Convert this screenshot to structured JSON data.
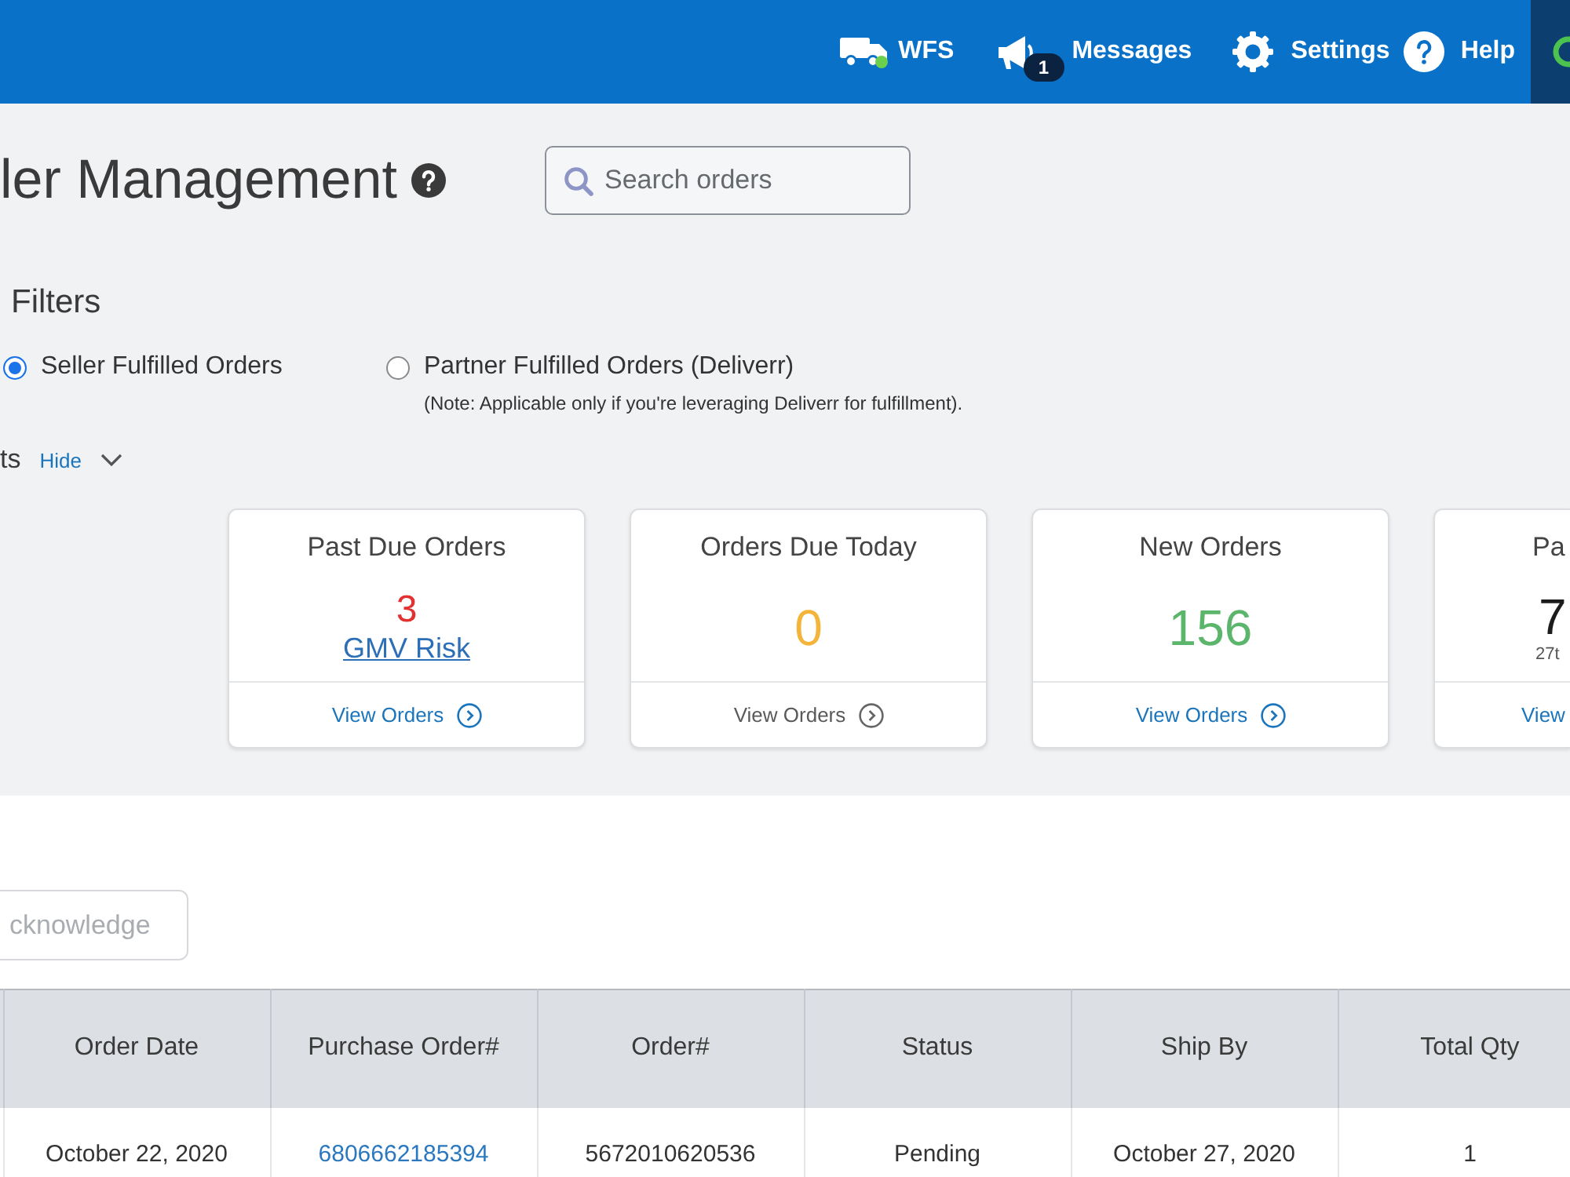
{
  "header": {
    "nav": [
      {
        "kind": "wfs",
        "label": "WFS"
      },
      {
        "kind": "messages",
        "label": "Messages",
        "badge": "1"
      },
      {
        "kind": "settings",
        "label": "Settings"
      },
      {
        "kind": "help",
        "label": "Help"
      }
    ]
  },
  "page": {
    "title": "ler Management",
    "search": {
      "placeholder": "Search orders"
    }
  },
  "filters": {
    "title": "Filters",
    "options": [
      {
        "label": "Seller Fulfilled Orders",
        "selected": true
      },
      {
        "label": "Partner Fulfilled Orders (Deliverr)",
        "selected": false,
        "note": "(Note: Applicable only if you're leveraging Deliverr for fulfillment)."
      }
    ]
  },
  "alerts": {
    "title": "ts",
    "toggle": "Hide",
    "cards": [
      {
        "kind": "whole",
        "title": "Past Due Orders",
        "value": "3",
        "color": "#e2312f",
        "link": "GMV Risk",
        "footer": {
          "label": "View Orders",
          "disabled": false
        }
      },
      {
        "kind": "whole",
        "title": "Orders Due Today",
        "value": "0",
        "color": "#f4b43a",
        "footer": {
          "label": "View Orders",
          "disabled": true
        }
      },
      {
        "kind": "whole",
        "title": "New Orders",
        "value": "156",
        "color": "#5bb56a",
        "footer": {
          "label": "View Orders",
          "disabled": false
        }
      },
      {
        "kind": "clipped",
        "title": "Pa",
        "value": "7",
        "color": "#1c1c1c",
        "subtext": "27t",
        "footer": {
          "label": "View",
          "disabled": false
        }
      }
    ]
  },
  "actions": {
    "acknowledge": {
      "label": "cknowledge",
      "disabled": true
    }
  },
  "table": {
    "columns": [
      "Order Date",
      "Purchase Order#",
      "Order#",
      "Status",
      "Ship By",
      "Total Qty"
    ],
    "rows": [
      {
        "cells": [
          {
            "kind": "text",
            "text": "October 22, 2020"
          },
          {
            "kind": "link",
            "text": "6806662185394"
          },
          {
            "kind": "text",
            "text": "5672010620536"
          },
          {
            "kind": "text",
            "text": "Pending"
          },
          {
            "kind": "text",
            "text": "October 27, 2020"
          },
          {
            "kind": "text",
            "text": "1"
          }
        ]
      }
    ]
  }
}
